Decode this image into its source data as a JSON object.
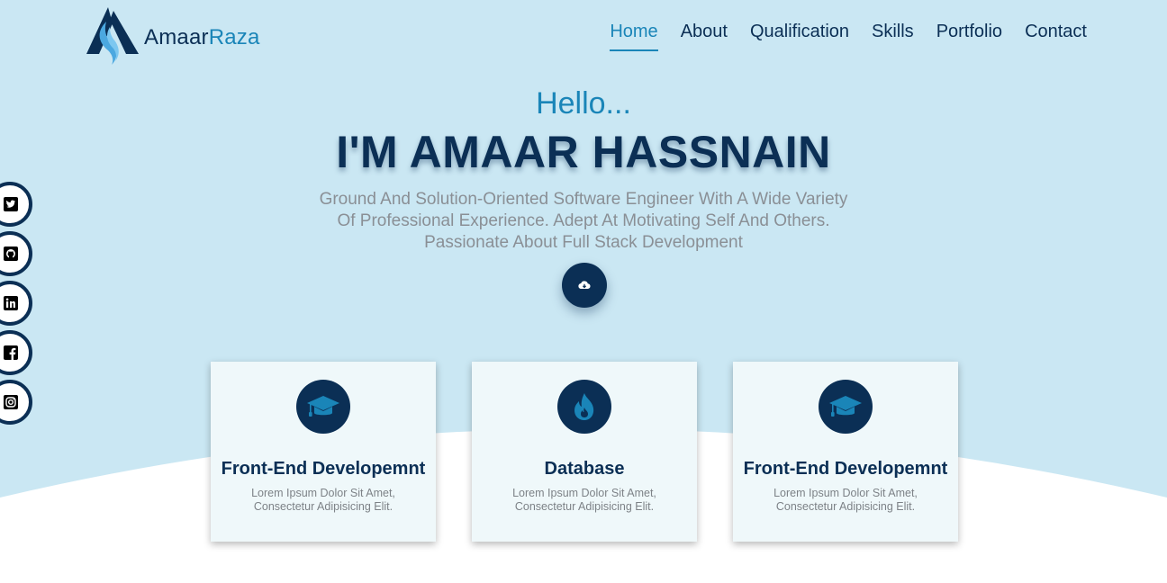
{
  "brand": {
    "name_part1": "Amaar",
    "name_part2": "Raza"
  },
  "nav": {
    "items": [
      "Home",
      "About",
      "Qualification",
      "Skills",
      "Portfolio",
      "Contact"
    ],
    "active": "Home"
  },
  "hero": {
    "greeting": "Hello...",
    "name": "I'M AMAAR HASSNAIN",
    "description_lines": [
      "Ground And Solution-Oriented Software Engineer With A Wide Variety",
      "Of Professional Experience. Adept At Motivating Self And Others.",
      "Passionate About Full Stack Development"
    ],
    "download_icon": "cloud-download-icon"
  },
  "social": [
    {
      "icon": "twitter-icon"
    },
    {
      "icon": "github-icon"
    },
    {
      "icon": "linkedin-icon"
    },
    {
      "icon": "facebook-icon"
    },
    {
      "icon": "instagram-icon"
    }
  ],
  "cards": [
    {
      "icon": "graduation-cap-icon",
      "title": "Front-End Developemnt",
      "text_line1": "Lorem Ipsum Dolor Sit Amet,",
      "text_line2": "Consectetur Adipisicing Elit."
    },
    {
      "icon": "fire-icon",
      "title": "Database",
      "text_line1": "Lorem Ipsum Dolor Sit Amet,",
      "text_line2": "Consectetur Adipisicing Elit."
    },
    {
      "icon": "graduation-cap-icon",
      "title": "Front-End Developemnt",
      "text_line1": "Lorem Ipsum Dolor Sit Amet,",
      "text_line2": "Consectetur Adipisicing Elit."
    }
  ],
  "colors": {
    "hero_bg": "#cae7f3",
    "primary_dark": "#0b2f55",
    "accent": "#1a85b8",
    "muted_text": "#8a8f95",
    "card_bg": "#eff8fa"
  }
}
